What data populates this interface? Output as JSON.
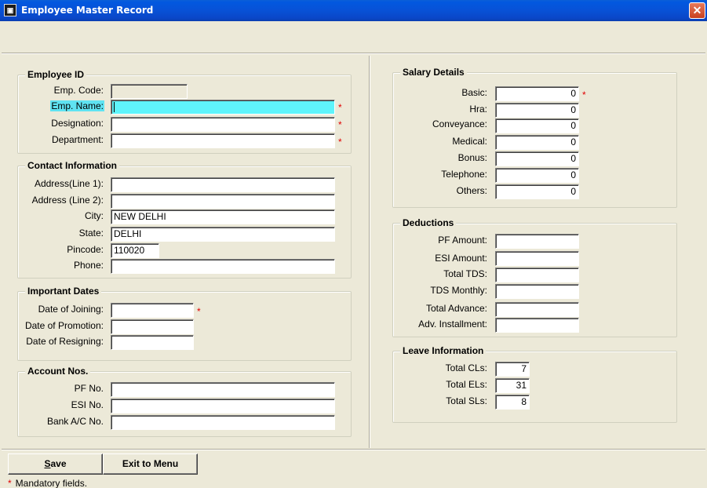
{
  "window": {
    "title": "Employee Master Record",
    "close_glyph": "✕",
    "app_icon": "app-icon"
  },
  "employee_id": {
    "title": "Employee ID",
    "emp_code_label": "Emp. Code:",
    "emp_code_value": "",
    "emp_name_label": "Emp. Name:",
    "emp_name_value": "",
    "designation_label": "Designation:",
    "designation_value": "",
    "department_label": "Department:",
    "department_value": ""
  },
  "contact": {
    "title": "Contact Information",
    "address1_label": "Address(Line 1):",
    "address1_value": "",
    "address2_label": "Address (Line 2):",
    "address2_value": "",
    "city_label": "City:",
    "city_value": "NEW DELHI",
    "state_label": "State:",
    "state_value": "DELHI",
    "pincode_label": "Pincode:",
    "pincode_value": "110020",
    "phone_label": "Phone:",
    "phone_value": ""
  },
  "dates": {
    "title": "Important Dates",
    "joining_label": "Date of Joining:",
    "joining_value": "",
    "promotion_label": "Date of Promotion:",
    "promotion_value": "",
    "resigning_label": "Date of Resigning:",
    "resigning_value": ""
  },
  "accounts": {
    "title": "Account Nos.",
    "pf_label": "PF No.",
    "pf_value": "",
    "esi_label": "ESI No.",
    "esi_value": "",
    "bank_label": "Bank A/C No.",
    "bank_value": ""
  },
  "salary": {
    "title": "Salary Details",
    "basic_label": "Basic:",
    "basic_value": "0",
    "hra_label": "Hra:",
    "hra_value": "0",
    "conveyance_label": "Conveyance:",
    "conveyance_value": "0",
    "medical_label": "Medical:",
    "medical_value": "0",
    "bonus_label": "Bonus:",
    "bonus_value": "0",
    "telephone_label": "Telephone:",
    "telephone_value": "0",
    "others_label": "Others:",
    "others_value": "0"
  },
  "deductions": {
    "title": "Deductions",
    "pf_amount_label": "PF Amount:",
    "pf_amount_value": "",
    "esi_amount_label": "ESI Amount:",
    "esi_amount_value": "",
    "total_tds_label": "Total TDS:",
    "total_tds_value": "",
    "tds_monthly_label": "TDS Monthly:",
    "tds_monthly_value": "",
    "total_advance_label": "Total Advance:",
    "total_advance_value": "",
    "adv_installment_label": "Adv. Installment:",
    "adv_installment_value": ""
  },
  "leave": {
    "title": "Leave Information",
    "cls_label": "Total CLs:",
    "cls_value": "7",
    "els_label": "Total ELs:",
    "els_value": "31",
    "sls_label": "Total SLs:",
    "sls_value": "8"
  },
  "buttons": {
    "save_prefix": "S",
    "save_rest": "ave",
    "exit": "Exit to Menu"
  },
  "footer": {
    "mandatory_star": "*",
    "mandatory_note": "Mandatory fields."
  },
  "required_marker": "*",
  "colors": {
    "focus_field": "#5ff4fb",
    "label_highlight": "#5fe3f2",
    "required": "#e00000",
    "titlebar": "#0851d6"
  }
}
